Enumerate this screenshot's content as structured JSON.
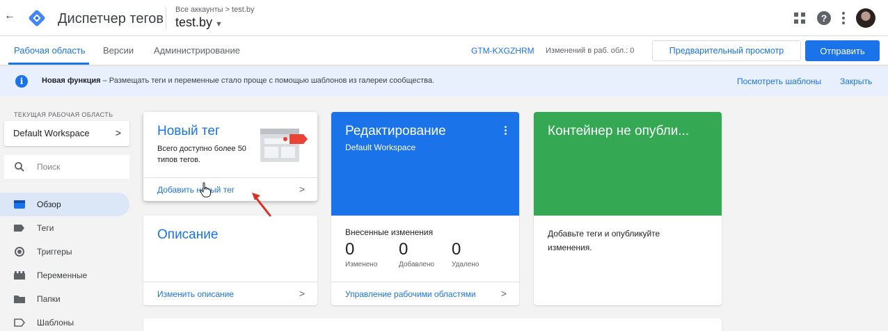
{
  "header": {
    "app_title": "Диспетчер тегов",
    "breadcrumb": "Все аккаунты > test.by",
    "account": "test.by",
    "icons": [
      "back-arrow-icon",
      "gtm-logo-icon",
      "apps-grid-icon",
      "help-icon",
      "more-vert-icon"
    ]
  },
  "nav": {
    "tabs": [
      {
        "label": "Рабочая область",
        "active": true
      },
      {
        "label": "Версии",
        "active": false
      },
      {
        "label": "Администрирование",
        "active": false
      }
    ],
    "container_id": "GTM-KXGZHRM",
    "changes_text": "Изменений в раб. обл.: 0",
    "preview_label": "Предварительный просмотр",
    "submit_label": "Отправить"
  },
  "banner": {
    "bold": "Новая функция",
    "text": " – Размещать теги и переменные стало проще с помощью шаблонов из галереи сообщества.",
    "view_templates": "Посмотреть шаблоны",
    "close": "Закрыть"
  },
  "sidebar": {
    "workspace_label": "ТЕКУЩАЯ РАБОЧАЯ ОБЛАСТЬ",
    "workspace_name": "Default Workspace",
    "search_placeholder": "Поиск",
    "items": [
      {
        "label": "Обзор",
        "icon": "overview-icon",
        "active": true
      },
      {
        "label": "Теги",
        "icon": "tag-icon",
        "active": false
      },
      {
        "label": "Триггеры",
        "icon": "trigger-icon",
        "active": false
      },
      {
        "label": "Переменные",
        "icon": "variables-icon",
        "active": false
      },
      {
        "label": "Папки",
        "icon": "folder-icon",
        "active": false
      },
      {
        "label": "Шаблоны",
        "icon": "template-icon",
        "active": false
      }
    ]
  },
  "cards": {
    "new_tag": {
      "title": "Новый тег",
      "desc": "Всего доступно более 50 типов тегов.",
      "link": "Добавить новый тег"
    },
    "description": {
      "title": "Описание",
      "link": "Изменить описание"
    },
    "editing": {
      "title": "Редактирование",
      "subtitle": "Default Workspace",
      "changes_label": "Внесенные изменения",
      "stats": [
        {
          "value": "0",
          "caption": "Изменено"
        },
        {
          "value": "0",
          "caption": "Добавлено"
        },
        {
          "value": "0",
          "caption": "Удалено"
        }
      ],
      "link": "Управление рабочими областями"
    },
    "container": {
      "title": "Контейнер не опубли...",
      "body": "Добавьте теги и опубликуйте изменения."
    }
  },
  "colors": {
    "accent": "#1a73e8",
    "green": "#34a853",
    "banner_bg": "#e8f0fe",
    "annotation_arrow": "#d93025"
  }
}
